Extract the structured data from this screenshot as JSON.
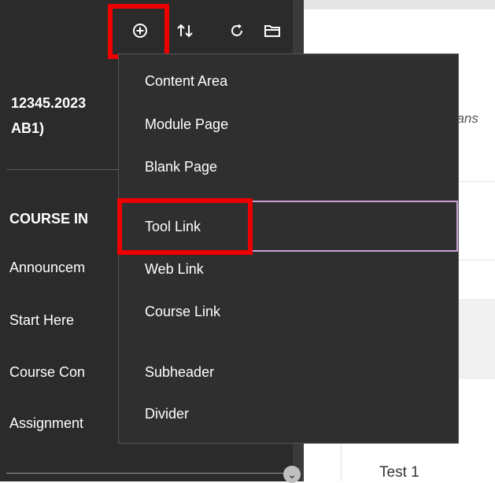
{
  "sidebar": {
    "toolbar": {
      "add_icon": "plus-circle",
      "sort_icon": "up-down-arrows",
      "refresh_icon": "refresh",
      "folder_icon": "folder"
    },
    "course_title": "12345.2023\nAB1)",
    "section_heading": "COURSE IN",
    "items": [
      {
        "label": "Announcem"
      },
      {
        "label": "Start Here"
      },
      {
        "label": "Course Con"
      },
      {
        "label": "Assignment"
      }
    ]
  },
  "content": {
    "hint_text": "eans",
    "test_label": "Test 1"
  },
  "add_menu": {
    "items": [
      {
        "label": "Content Area"
      },
      {
        "label": "Module Page"
      },
      {
        "label": "Blank Page"
      },
      {
        "label": "Tool Link"
      },
      {
        "label": "Web Link"
      },
      {
        "label": "Course Link"
      },
      {
        "label": "Subheader"
      },
      {
        "label": "Divider"
      }
    ],
    "selected_label": "Tool Link"
  },
  "colors": {
    "sidebar_bg": "#2b2b2b",
    "menu_bg": "#2f2f2f",
    "highlight": "#ee0000",
    "selected_outline": "#c8a2d8"
  }
}
